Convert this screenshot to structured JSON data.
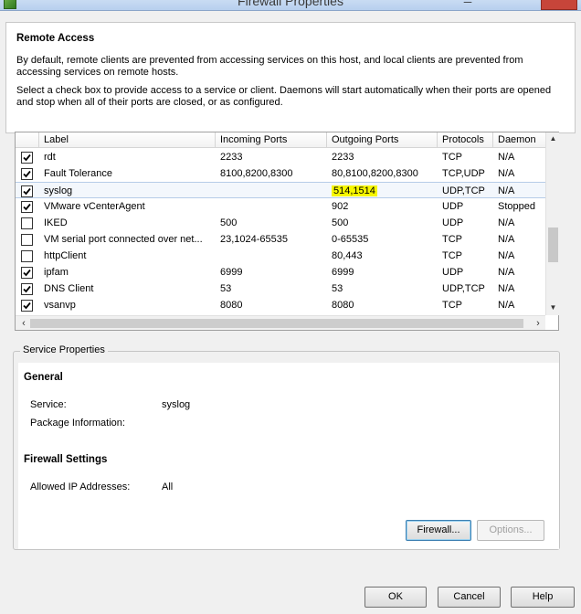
{
  "window": {
    "title": "Firewall Properties"
  },
  "remote_access": {
    "title": "Remote Access",
    "desc1": "By default, remote clients are prevented from accessing services on this host, and local clients are prevented from accessing services on remote hosts.",
    "desc2": "Select a check box to provide access to a service or client. Daemons will start automatically when their ports are opened and stop when all of their ports are closed, or as configured."
  },
  "table": {
    "columns": [
      "Label",
      "Incoming Ports",
      "Outgoing Ports",
      "Protocols",
      "Daemon"
    ],
    "rows": [
      {
        "checked": true,
        "label": "rdt",
        "incoming": "2233",
        "outgoing": "2233",
        "protocols": "TCP",
        "daemon": "N/A"
      },
      {
        "checked": true,
        "label": "Fault Tolerance",
        "incoming": "8100,8200,8300",
        "outgoing": "80,8100,8200,8300",
        "protocols": "TCP,UDP",
        "daemon": "N/A"
      },
      {
        "checked": true,
        "label": "syslog",
        "incoming": "",
        "outgoing": "514,1514",
        "protocols": "UDP,TCP",
        "daemon": "N/A"
      },
      {
        "checked": true,
        "label": "VMware vCenterAgent",
        "incoming": "",
        "outgoing": "902",
        "protocols": "UDP",
        "daemon": "Stopped"
      },
      {
        "checked": false,
        "label": "IKED",
        "incoming": "500",
        "outgoing": "500",
        "protocols": "UDP",
        "daemon": "N/A"
      },
      {
        "checked": false,
        "label": "VM serial port connected over net...",
        "incoming": "23,1024-65535",
        "outgoing": "0-65535",
        "protocols": "TCP",
        "daemon": "N/A"
      },
      {
        "checked": false,
        "label": "httpClient",
        "incoming": "",
        "outgoing": "80,443",
        "protocols": "TCP",
        "daemon": "N/A"
      },
      {
        "checked": true,
        "label": "ipfam",
        "incoming": "6999",
        "outgoing": "6999",
        "protocols": "UDP",
        "daemon": "N/A"
      },
      {
        "checked": true,
        "label": "DNS Client",
        "incoming": "53",
        "outgoing": "53",
        "protocols": "UDP,TCP",
        "daemon": "N/A"
      },
      {
        "checked": true,
        "label": "vsanvp",
        "incoming": "8080",
        "outgoing": "8080",
        "protocols": "TCP",
        "daemon": "N/A"
      }
    ]
  },
  "service_properties": {
    "legend": "Service Properties",
    "general_title": "General",
    "service_label": "Service:",
    "service_value": "syslog",
    "package_label": "Package Information:",
    "package_value": "",
    "firewall_settings_title": "Firewall Settings",
    "allowed_ip_label": "Allowed IP Addresses:",
    "allowed_ip_value": "All",
    "firewall_button": "Firewall...",
    "options_button": "Options..."
  },
  "dialog_buttons": {
    "ok": "OK",
    "cancel": "Cancel",
    "help": "Help"
  },
  "highlight_color": "#f7f700"
}
